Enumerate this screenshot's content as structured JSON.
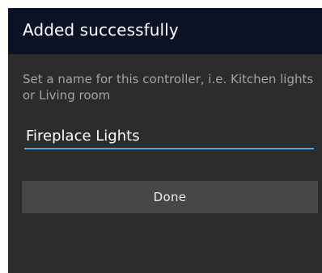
{
  "dialog": {
    "title": "Added successfully",
    "instructions": "Set a name for this controller, i.e. Kitchen lights or Living room",
    "name_input": {
      "value": "Fireplace Lights"
    },
    "done_label": "Done"
  },
  "colors": {
    "header_background": "#0b1226",
    "dialog_background": "#2c2c2c",
    "input_underline_accent": "#46a6ea",
    "button_background": "#474747",
    "instruction_text": "#a4a4a4"
  }
}
